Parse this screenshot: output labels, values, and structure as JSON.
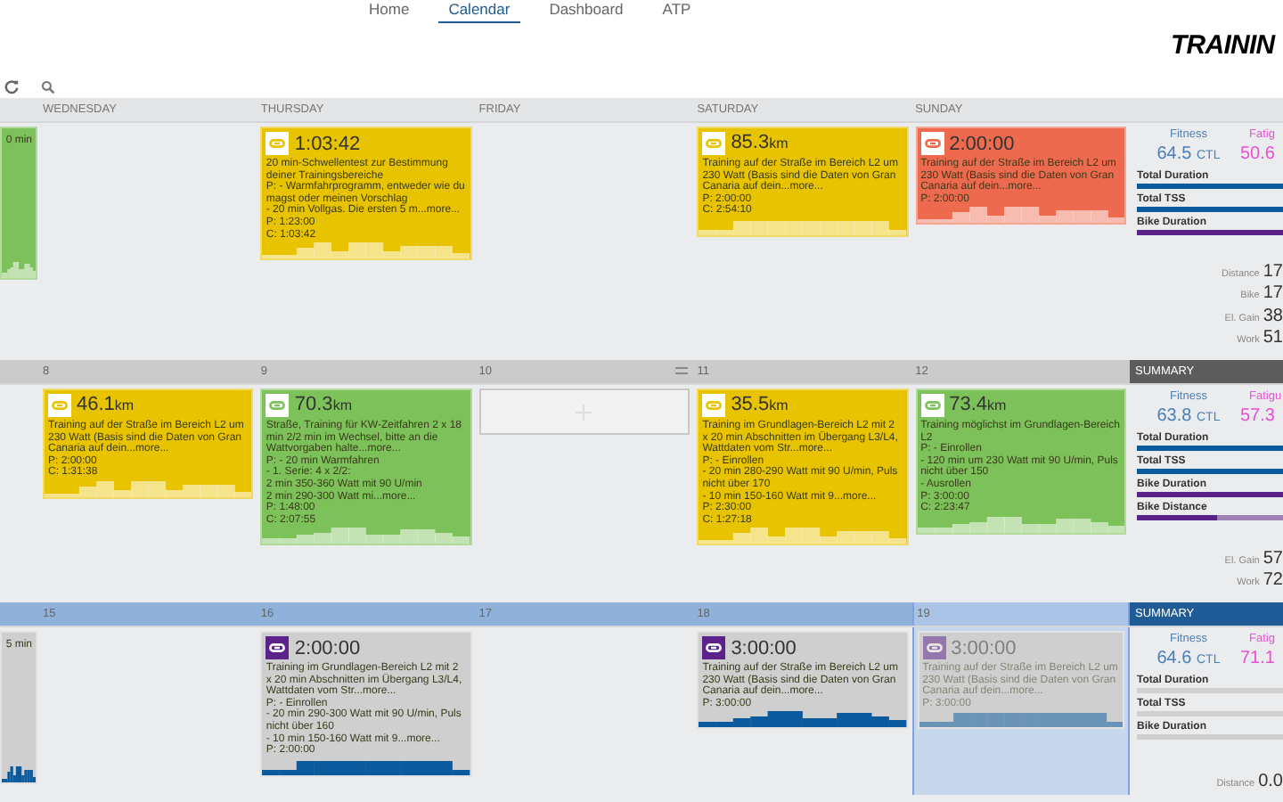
{
  "nav": [
    {
      "label": "Home",
      "selected": false
    },
    {
      "label": "Calendar",
      "selected": true
    },
    {
      "label": "Dashboard",
      "selected": false
    },
    {
      "label": "ATP",
      "selected": false
    }
  ],
  "logo": "TRAININ",
  "weeks": [
    {
      "kind": "plain",
      "days": [
        {
          "selected": false,
          "workout": {
            "color": "#7dc15a",
            "kind": "light",
            "description": "0 min"
          }
        },
        {
          "label": "WEDNESDAY",
          "selected": false
        },
        {
          "label": "THURSDAY",
          "selected": false,
          "workout": {
            "color": "#e8c300",
            "kind": "light",
            "metric": "1:03:42",
            "description": "20 min-Schwellentest zur Bestimmung deiner Trainingsbereiche\nP: - Warmfahrprogramm, entweder wie du magst oder meinen Vorschlag\n- 20 min Vollgas. Die ersten 5 m...more...",
            "lines": [
              "P: 1:23:00",
              "C: 1:03:42"
            ]
          }
        },
        {
          "label": "FRIDAY",
          "selected": false
        },
        {
          "label": "SATURDAY",
          "selected": false,
          "workout": {
            "color": "#e8c300",
            "kind": "light",
            "metric": "85.3",
            "unit": "km",
            "description": "Training auf der Straße im Bereich L2 um 230 Watt (Basis sind die Daten von Gran Canaria auf dein...more...",
            "lines": [
              "P: 2:00:00",
              "C: 2:54:10"
            ]
          }
        },
        {
          "label": "SUNDAY",
          "selected": false,
          "workout": {
            "color": "#ee6a4e",
            "kind": "light",
            "metric": "2:00:00",
            "description": "Training auf der Straße im Bereich L2 um 230 Watt (Basis sind die Daten von Gran Canaria auf dein...more...",
            "lines": [
              "P: 2:00:00"
            ]
          }
        }
      ],
      "summary": {
        "fitness_label": "Fitness",
        "fitness": "64.5",
        "fitness_unit": "CTL",
        "fatigue_label": "Fatig",
        "fatigue": "50.6",
        "bars": [
          {
            "label": "Total Duration",
            "color": "#0b5a9e",
            "level": 1
          },
          {
            "label": "Total TSS",
            "color": "#0b5a9e",
            "level": 1
          },
          {
            "label": "Bike Duration",
            "color": "#5b2389",
            "level": 1
          }
        ],
        "stats": [
          {
            "label": "Distance",
            "value": "17"
          },
          {
            "label": "Bike",
            "value": "17"
          },
          {
            "label": "El. Gain",
            "value": "38"
          },
          {
            "label": "Work",
            "value": "51"
          }
        ]
      }
    },
    {
      "kind": "gray",
      "days": [
        {
          "selected": false
        },
        {
          "label": "8",
          "selected": false,
          "workout": {
            "color": "#e8c300",
            "kind": "light",
            "metric": "46.1",
            "unit": "km",
            "description": "Training auf der Straße im Bereich L2 um 230 Watt (Basis sind die Daten von Gran Canaria auf dein...more...",
            "lines": [
              "P: 2:00:00",
              "C: 1:31:38"
            ]
          }
        },
        {
          "label": "9",
          "selected": false,
          "workout": {
            "color": "#7dc15a",
            "kind": "light",
            "metric": "70.3",
            "unit": "km",
            "description": "Straße, Training für KW-Zeitfahren 2 x 18 min 2/2 min im Wechsel, bitte an die Wattvorgaben halte...more...\nP: - 20 min Warmfahren\n- 1. Serie: 4 x 2/2:\n2 min 350-360 Watt mit 90 U/min\n2 min 290-300 Watt mi...more...",
            "lines": [
              "P: 1:48:00",
              "C: 2:07:55"
            ]
          }
        },
        {
          "label": "10",
          "selected": false,
          "menu": true,
          "add_slot": true
        },
        {
          "label": "11",
          "selected": false,
          "workout": {
            "color": "#e8c300",
            "kind": "light",
            "metric": "35.5",
            "unit": "km",
            "description": "Training im Grundlagen-Bereich L2 mit 2 x 20 min Abschnitten im Übergang L3/L4, Wattdaten vom Str...more...\nP: - Einrollen\n- 20 min 280-290 Watt mit 90 U/min, Puls nicht über 170\n- 10 min 150-160 Watt mit 9...more...",
            "lines": [
              "P: 2:30:00",
              "C: 1:27:18"
            ]
          }
        },
        {
          "label": "12",
          "selected": false,
          "workout": {
            "color": "#7dc15a",
            "kind": "light",
            "metric": "73.4",
            "unit": "km",
            "description": "Training möglichst im Grundlagen-Bereich L2\nP: - Einrollen\n- 120 min  um 230 Watt mit 90 U/min, Puls nicht über 150\n- Ausrollen",
            "lines": [
              "P: 3:00:00",
              "C: 2:23:47"
            ]
          }
        }
      ],
      "summary": {
        "title": "SUMMARY",
        "fitness_label": "Fitness",
        "fitness": "63.8",
        "fitness_unit": "CTL",
        "fatigue_label": "Fatigu",
        "fatigue": "57.3",
        "bars": [
          {
            "label": "Total Duration",
            "color": "#0b5a9e",
            "level": 1
          },
          {
            "label": "Total TSS",
            "color": "#0b5a9e",
            "level": 1
          },
          {
            "label": "Bike Duration",
            "color": "#5b2389",
            "level": 1
          },
          {
            "label": "Bike Distance",
            "color": "#5b2389",
            "level": 0.5
          }
        ],
        "stats": [
          {
            "label": "El. Gain",
            "value": "57"
          },
          {
            "label": "Work",
            "value": "72"
          }
        ]
      }
    },
    {
      "kind": "blue",
      "days": [
        {
          "selected": false,
          "workout": {
            "color": "#cfcfcf",
            "kind": "dark",
            "description": "5 min"
          }
        },
        {
          "label": "15",
          "selected": false
        },
        {
          "label": "16",
          "selected": false,
          "workout": {
            "color": "#cfcfcf",
            "kind": "dark",
            "metric": "2:00:00",
            "description": "Training im Grundlagen-Bereich L2 mit 2 x 20 min Abschnitten im Übergang L3/L4, Wattdaten vom Str...more...\nP: - Einrollen\n- 20 min 290-300 Watt mit 90 U/min, Puls nicht über 160\n- 10 min 150-160 Watt mit 9...more...",
            "lines": [
              "P: 2:00:00"
            ]
          }
        },
        {
          "label": "17",
          "selected": false
        },
        {
          "label": "18",
          "selected": false,
          "workout": {
            "color": "#cfcfcf",
            "kind": "dark",
            "metric": "3:00:00",
            "description": "Training auf der Straße im Bereich L2 um 230 Watt (Basis sind die Daten von Gran Canaria auf dein...more...",
            "lines": [
              "P: 3:00:00"
            ]
          }
        },
        {
          "label": "19",
          "selected": true,
          "workout": {
            "color": "#cfcfcf",
            "kind": "dark",
            "metric": "3:00:00",
            "description": "Training auf der Straße im Bereich L2 um 230 Watt (Basis sind die Daten von Gran Canaria auf dein...more...",
            "lines": [
              "P: 3:00:00"
            ]
          }
        }
      ],
      "summary": {
        "title": "SUMMARY",
        "fitness_label": "Fitness",
        "fitness": "64.6",
        "fitness_unit": "CTL",
        "fatigue_label": "Fatig",
        "fatigue": "71.1",
        "bars": [
          {
            "label": "Total Duration",
            "level": 0
          },
          {
            "label": "Total TSS",
            "level": 0
          },
          {
            "label": "Bike Duration",
            "level": 0
          }
        ],
        "stats": [
          {
            "label": "Distance",
            "value": "0.0"
          }
        ]
      }
    }
  ]
}
